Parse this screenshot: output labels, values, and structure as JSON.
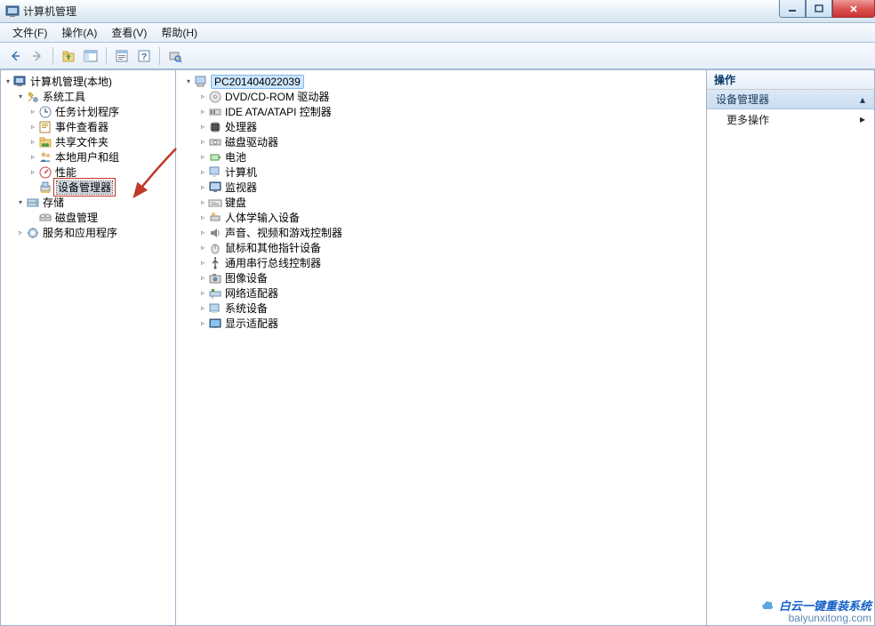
{
  "window": {
    "title": "计算机管理"
  },
  "menu": {
    "file": "文件(F)",
    "action": "操作(A)",
    "view": "查看(V)",
    "help": "帮助(H)"
  },
  "left_tree": {
    "root": "计算机管理(本地)",
    "system_tools": "系统工具",
    "task_scheduler": "任务计划程序",
    "event_viewer": "事件查看器",
    "shared_folders": "共享文件夹",
    "local_users": "本地用户和组",
    "performance": "性能",
    "device_manager": "设备管理器",
    "storage": "存储",
    "disk_management": "磁盘管理",
    "services_apps": "服务和应用程序"
  },
  "center_tree": {
    "computer_name": "PC201404022039",
    "dvd": "DVD/CD-ROM 驱动器",
    "ide": "IDE ATA/ATAPI 控制器",
    "processor": "处理器",
    "disk_drives": "磁盘驱动器",
    "battery": "电池",
    "computer": "计算机",
    "monitor": "监视器",
    "keyboard": "键盘",
    "hid": "人体学输入设备",
    "sound": "声音、视频和游戏控制器",
    "mouse": "鼠标和其他指针设备",
    "usb": "通用串行总线控制器",
    "imaging": "图像设备",
    "network": "网络适配器",
    "system_devices": "系统设备",
    "display": "显示适配器"
  },
  "right_panel": {
    "header": "操作",
    "section": "设备管理器",
    "more_actions": "更多操作"
  },
  "watermark": {
    "line1": "白云一键重装系统",
    "line2": "baiyunxitong.com"
  }
}
